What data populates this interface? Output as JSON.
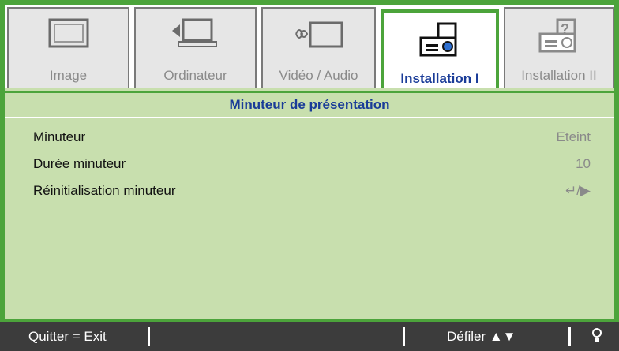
{
  "tabs": [
    {
      "label": "Image",
      "icon": "monitor-icon"
    },
    {
      "label": "Ordinateur",
      "icon": "computer-icon"
    },
    {
      "label": "Vidéo / Audio",
      "icon": "video-audio-icon"
    },
    {
      "label": "Installation I",
      "icon": "projector-icon"
    },
    {
      "label": "Installation II",
      "icon": "projector-help-icon"
    }
  ],
  "active_tab_index": 3,
  "panel": {
    "title": "Minuteur de présentation",
    "rows": [
      {
        "label": "Minuteur",
        "value": "Eteint"
      },
      {
        "label": "Durée minuteur",
        "value": "10"
      },
      {
        "label": "Réinitialisation minuteur",
        "value": "↵/▶"
      }
    ]
  },
  "footer": {
    "exit": "Quitter = Exit",
    "scroll": "Défiler ▲▼",
    "light_icon": "bulb-icon"
  },
  "colors": {
    "accent": "#4ca43b",
    "panel": "#c8dfae",
    "title": "#1a3c98"
  }
}
